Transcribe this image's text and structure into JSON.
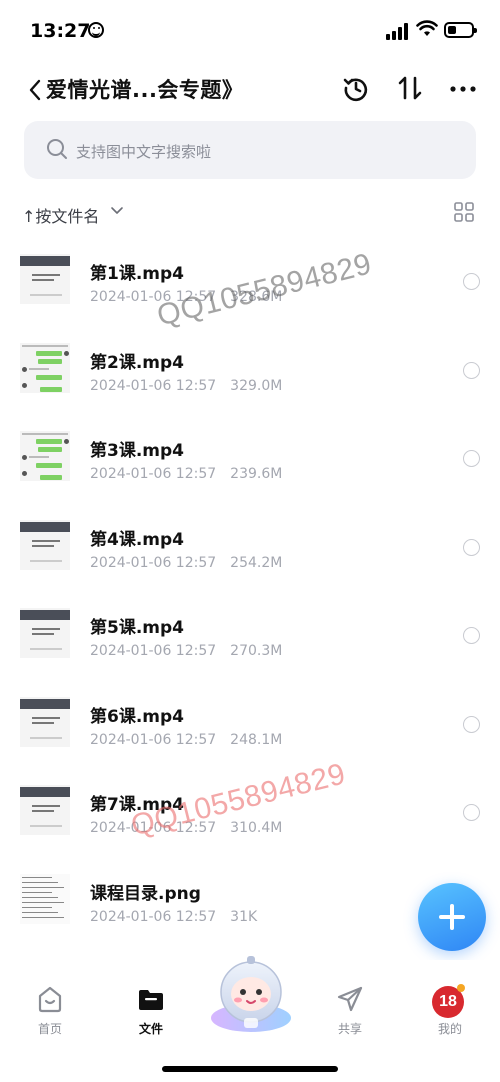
{
  "status_bar": {
    "time": "13:27"
  },
  "header": {
    "title": "爱情光谱...会专题》"
  },
  "search": {
    "placeholder": "支持图中文字搜索啦"
  },
  "sort": {
    "label": "↑按文件名"
  },
  "files": [
    {
      "name": "第1课.mp4",
      "date": "2024-01-06 12:57",
      "size": "328.6M",
      "thumb": "slide"
    },
    {
      "name": "第2课.mp4",
      "date": "2024-01-06 12:57",
      "size": "329.0M",
      "thumb": "chat"
    },
    {
      "name": "第3课.mp4",
      "date": "2024-01-06 12:57",
      "size": "239.6M",
      "thumb": "chat"
    },
    {
      "name": "第4课.mp4",
      "date": "2024-01-06 12:57",
      "size": "254.2M",
      "thumb": "slide"
    },
    {
      "name": "第5课.mp4",
      "date": "2024-01-06 12:57",
      "size": "270.3M",
      "thumb": "slide"
    },
    {
      "name": "第6课.mp4",
      "date": "2024-01-06 12:57",
      "size": "248.1M",
      "thumb": "slide"
    },
    {
      "name": "第7课.mp4",
      "date": "2024-01-06 12:57",
      "size": "310.4M",
      "thumb": "slide"
    },
    {
      "name": "课程目录.png",
      "date": "2024-01-06 12:57",
      "size": "31K",
      "thumb": "doc"
    }
  ],
  "watermarks": [
    "QQ1055894829",
    "QQ1055894829"
  ],
  "tabs": [
    {
      "id": "home",
      "label": "首页"
    },
    {
      "id": "files",
      "label": "文件"
    },
    {
      "id": "share",
      "label": "共享"
    },
    {
      "id": "mine",
      "label": "我的"
    }
  ],
  "profile_badge": "18",
  "colors": {
    "accent": "#2f86f5",
    "meta_text": "#a4a7b0",
    "search_bg": "#f1f2f6",
    "badge": "#d8292f"
  }
}
